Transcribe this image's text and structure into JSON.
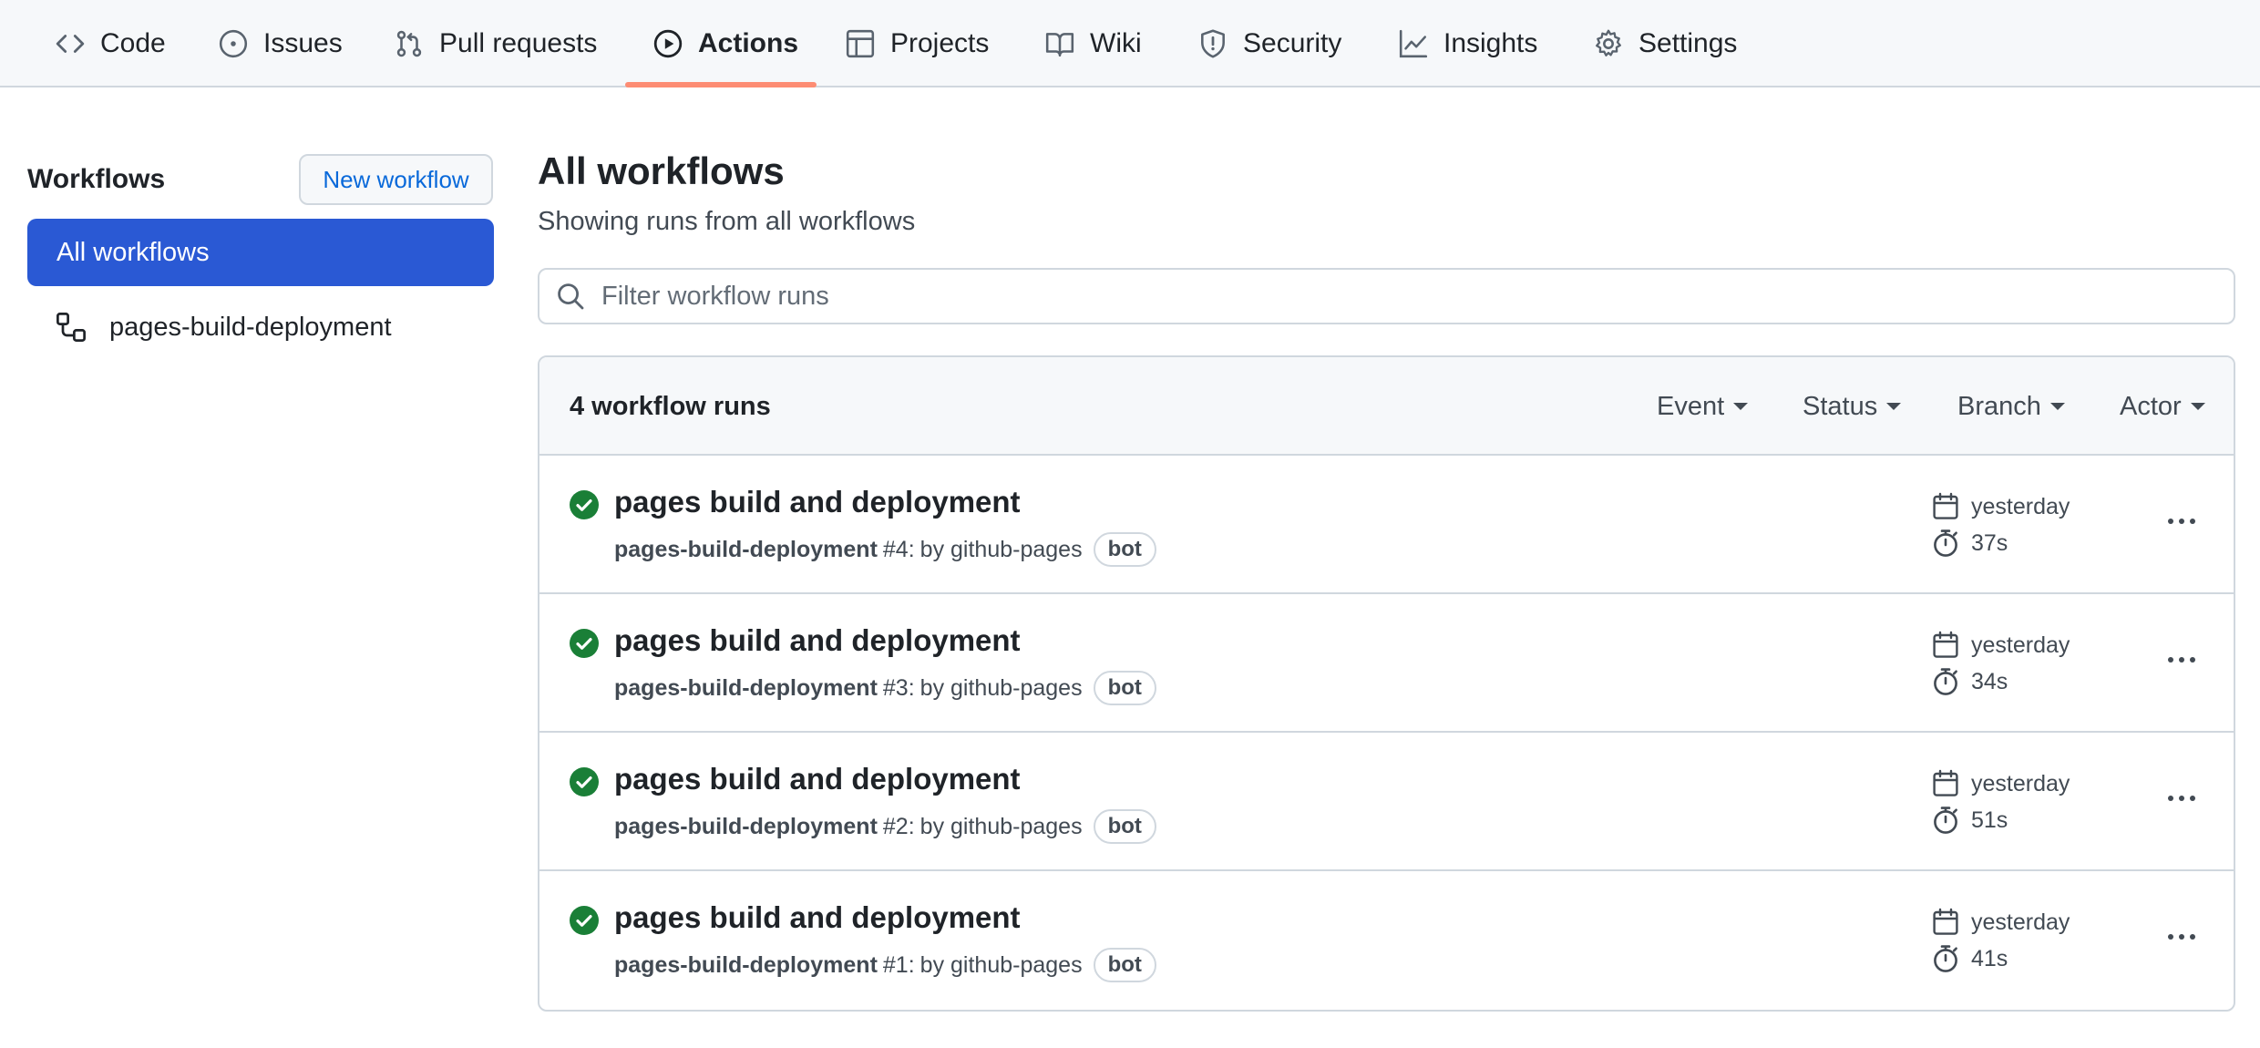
{
  "nav": {
    "items": [
      {
        "label": "Code",
        "icon": "code-icon"
      },
      {
        "label": "Issues",
        "icon": "issue-icon"
      },
      {
        "label": "Pull requests",
        "icon": "pull-request-icon"
      },
      {
        "label": "Actions",
        "icon": "play-icon",
        "selected": true
      },
      {
        "label": "Projects",
        "icon": "table-icon"
      },
      {
        "label": "Wiki",
        "icon": "book-icon"
      },
      {
        "label": "Security",
        "icon": "shield-icon"
      },
      {
        "label": "Insights",
        "icon": "graph-icon"
      },
      {
        "label": "Settings",
        "icon": "gear-icon"
      }
    ],
    "underline_color": "#fd8c73"
  },
  "sidebar": {
    "title": "Workflows",
    "new_button": "New workflow",
    "items": [
      {
        "label": "All workflows",
        "selected": true
      },
      {
        "label": "pages-build-deployment",
        "icon": "workflow-icon"
      }
    ],
    "selected_color": "#2a59d4"
  },
  "main": {
    "title": "All workflows",
    "subtitle": "Showing runs from all workflows",
    "filter_placeholder": "Filter workflow runs"
  },
  "runs": {
    "count_label": "4 workflow runs",
    "filters": [
      "Event",
      "Status",
      "Branch",
      "Actor"
    ],
    "items": [
      {
        "title": "pages build and deployment",
        "workflow": "pages-build-deployment",
        "run": "#4:",
        "by": "by github-pages",
        "badge": "bot",
        "when": "yesterday",
        "duration": "37s",
        "status": "success"
      },
      {
        "title": "pages build and deployment",
        "workflow": "pages-build-deployment",
        "run": "#3:",
        "by": "by github-pages",
        "badge": "bot",
        "when": "yesterday",
        "duration": "34s",
        "status": "success"
      },
      {
        "title": "pages build and deployment",
        "workflow": "pages-build-deployment",
        "run": "#2:",
        "by": "by github-pages",
        "badge": "bot",
        "when": "yesterday",
        "duration": "51s",
        "status": "success"
      },
      {
        "title": "pages build and deployment",
        "workflow": "pages-build-deployment",
        "run": "#1:",
        "by": "by github-pages",
        "badge": "bot",
        "when": "yesterday",
        "duration": "41s",
        "status": "success"
      }
    ],
    "success_color": "#1a7f37"
  }
}
